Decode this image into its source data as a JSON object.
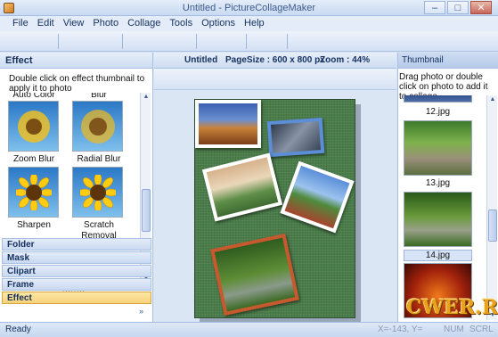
{
  "window": {
    "title": "Untitled - PictureCollageMaker",
    "minimize": "–",
    "maximize": "□",
    "close": "✕"
  },
  "menu": [
    "File",
    "Edit",
    "View",
    "Photo",
    "Collage",
    "Tools",
    "Options",
    "Help"
  ],
  "left": {
    "header": "Effect",
    "hint": "Double click on effect thumbnail to apply it to photo",
    "effects": [
      "Auto Color",
      "Blur",
      "Zoom Blur",
      "Radial Blur",
      "Sharpen",
      "Scratch Removal"
    ],
    "tabs": [
      "Folder",
      "Mask",
      "Clipart",
      "Frame",
      "Effect"
    ],
    "active_tab": "Effect",
    "splitter": "::::::::",
    "more": "»"
  },
  "center": {
    "doc_name": "Untitled",
    "page_size": "PageSize : 600 x 800 px",
    "zoom": "Zoom :  44%"
  },
  "right": {
    "header": "Thumbnail",
    "hint": "Drag photo or double click on photo to add it to collage",
    "thumbnails": [
      "12.jpg",
      "13.jpg",
      "14.jpg"
    ],
    "selected": "14.jpg"
  },
  "status": {
    "text": "Ready",
    "coords": "X=-143, Y=",
    "num": "NUM",
    "scrl": "SCRL"
  },
  "watermark": "CWER.RU",
  "colors": {
    "accent": "#15428b",
    "active_tab": "#f7d27a",
    "canvas": "#4a7d4a"
  }
}
